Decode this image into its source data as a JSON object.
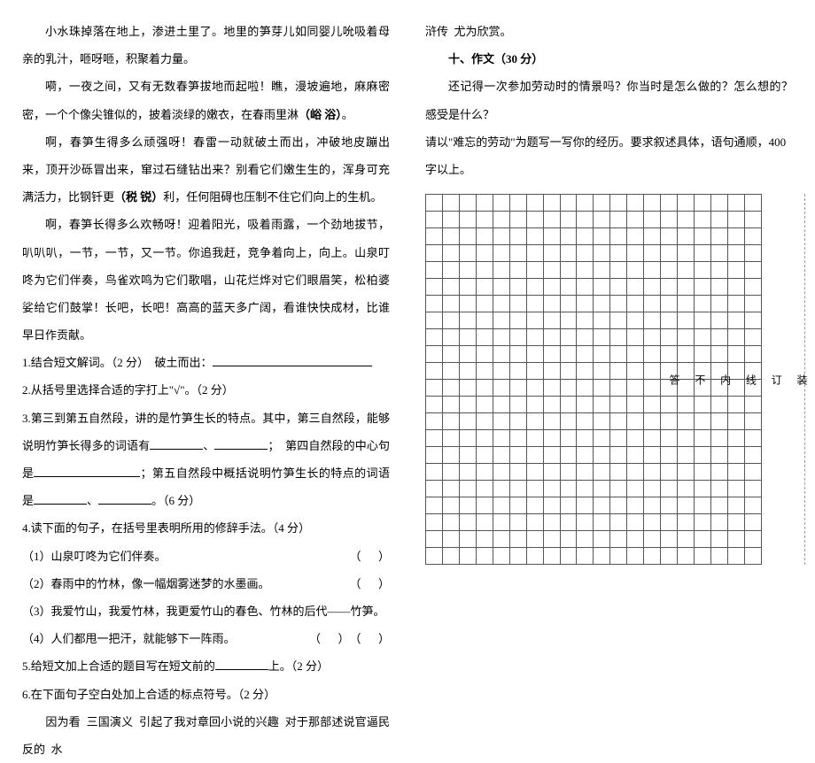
{
  "left": {
    "p1": "小水珠掉落在地上，渗进土里了。地里的笋芽儿如同婴儿吮吸着母亲的乳汁，咂呀咂，积聚着力量。",
    "p2_a": "嗬，一夜之间，又有无数春笋拔地而起啦！瞧，漫坡遍地，麻麻密密，一个个像尖锥似的，披着淡绿的嫩衣，在春雨里淋",
    "p2_b": "（峪 浴）",
    "p2_c": "。",
    "p3_a": "啊，春笋生得多么顽强呀！春雷一动就破土而出，冲破地皮蹦出来，顶开沙砾冒出来，窜过石缝钻出来？别看它们嫩生生的，浑身可充满活力，比钢钎更",
    "p3_b": "（税 锐）",
    "p3_c": "利，任何阻碍也压制不住它们向上的生机。",
    "p4": "啊，春笋长得多么欢畅呀！迎着阳光，吸着雨露，一个劲地拔节，叭叭叭，一节，一节，又一节。你追我赶，竞争着向上，向上。山泉叮咚为它们伴奏，鸟雀欢鸣为它们歌唱，山花烂烨对它们眼眉笑，松柏婆娑给它们鼓掌！长吧，长吧！高高的蓝天多广阔，看谁快快成材，比谁早日作贡献。",
    "q1": "1.结合短文解词。（2 分）  破土而出：",
    "q2": "2.从括号里选择合适的字打上\"√\"。（2 分）",
    "q3a": "3.第三到第五自然段，讲的是竹笋生长的特点。其中，第三自然段，能够说明竹笋长得多的词语有",
    "q3b": "、",
    "q3c": "；  第四自然段的中心句是",
    "q3d": "；第五自然段中概括说明竹笋生长的特点的词语是",
    "q3e": "、",
    "q3f": "。（6 分）",
    "q4": "4.读下面的句子，在括号里表明所用的修辞手法。（4 分）",
    "q4_1": "（1）山泉叮咚为它们伴奏。",
    "q4_2": "（2）春雨中的竹林，像一幅烟雾迷梦的水墨画。",
    "q4_3": "（3）我爱竹山，我爱竹林，我更爱竹山的春色、竹林的后代——竹笋。",
    "q4_4": "（4）人们都甩一把汗，就能够下一阵雨。",
    "paren": "（      ）",
    "q5a": "5.给短文加上合适的题目写在短文前的",
    "q5b": "上。（2 分）",
    "q6": "6.在下面句子空白处加上合适的标点符号。（2 分）",
    "q6s": "　　因为看  三国演义  引起了我对章回小说的兴趣  对于那部述说官逼民反的  水"
  },
  "right": {
    "cont": "浒传  尤为欣赏。",
    "h1": "十、作文（30 分）",
    "e1": "还记得一次参加劳动时的情景吗？你当时是怎么做的？怎么想的？感受是什么？",
    "e2": "请以\"难忘的劳动\"为题写一写你的经历。要求叙述具体，语句通顺，400 字以上。",
    "side": {
      "a": "装",
      "b": "订",
      "c": "线",
      "d": "内",
      "e": "不",
      "f": "答"
    }
  }
}
